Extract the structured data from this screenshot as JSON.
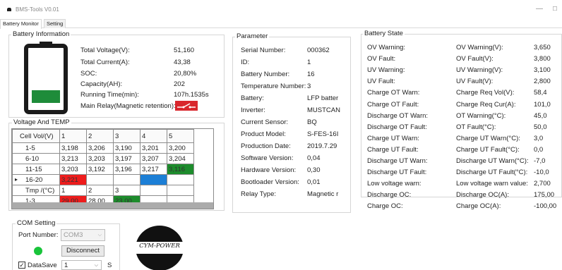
{
  "window": {
    "title": "BMS-Tools V0.01",
    "minimize_glyph": "—",
    "maximize_glyph": "☐"
  },
  "tabs": [
    "Battery Monitor",
    "Setting"
  ],
  "battery_info": {
    "title": "Battery Information",
    "soc_fill_color": "#1e8c3a",
    "relay_icon_color": "#d9262c",
    "rows": [
      {
        "label": "Total Voltage(V):",
        "value": "51,160"
      },
      {
        "label": "Total Current(A):",
        "value": "43,38"
      },
      {
        "label": "SOC:",
        "value": "20,80%"
      },
      {
        "label": "Capacity(AH):",
        "value": "202"
      },
      {
        "label": "Running Time(min):",
        "value": "107h.1535s"
      },
      {
        "label": "Main Relay(Magnetic retention):",
        "value": ""
      }
    ]
  },
  "voltage_temp": {
    "title": "Voltage And TEMP",
    "row_indicator": "▸",
    "header": [
      "Cell Vol/(V)",
      "1",
      "2",
      "3",
      "4",
      "5"
    ],
    "rows": [
      {
        "cells": [
          "1-5",
          "3,198",
          "3,206",
          "3,190",
          "3,201",
          "3,200"
        ],
        "colors": [
          "",
          "",
          "",
          "",
          "",
          ""
        ],
        "current": false
      },
      {
        "cells": [
          "6-10",
          "3,213",
          "3,203",
          "3,197",
          "3,207",
          "3,204"
        ],
        "colors": [
          "",
          "",
          "",
          "",
          "",
          ""
        ],
        "current": false
      },
      {
        "cells": [
          "11-15",
          "3,203",
          "3,192",
          "3,196",
          "3,217",
          "3,116"
        ],
        "colors": [
          "",
          "",
          "",
          "",
          "",
          "#1d8c2c"
        ],
        "current": false
      },
      {
        "cells": [
          "16-20",
          "3,221",
          "",
          "",
          "",
          ""
        ],
        "colors": [
          "",
          "#ee1c1c",
          "",
          "",
          "#1c7fd6",
          ""
        ],
        "current": true
      },
      {
        "cells": [
          "Tmp /(°C)",
          "1",
          "2",
          "3",
          "",
          ""
        ],
        "colors": [
          "",
          "",
          "",
          "",
          "",
          ""
        ],
        "current": false
      },
      {
        "cells": [
          "1-3",
          "29,00",
          "28,00",
          "23,00",
          "",
          ""
        ],
        "colors": [
          "",
          "#ee1c1c",
          "",
          "#1d8c2c",
          "",
          ""
        ],
        "current": false
      }
    ]
  },
  "parameter": {
    "title": "Parameter",
    "rows": [
      {
        "label": "Serial Number:",
        "value": "000362"
      },
      {
        "label": "ID:",
        "value": "1"
      },
      {
        "label": "Battery Number:",
        "value": "16"
      },
      {
        "label": "Temperature Number:",
        "value": "3"
      },
      {
        "label": "Battery:",
        "value": "LFP batter"
      },
      {
        "label": "Inverter:",
        "value": "MUSTCAN"
      },
      {
        "label": "Current Sensor:",
        "value": "BQ"
      },
      {
        "label": "Product Model:",
        "value": "S-FES-16I"
      },
      {
        "label": "Production Date:",
        "value": "2019.7.29"
      },
      {
        "label": "Software Version:",
        "value": "0,04"
      },
      {
        "label": "Hardware Version:",
        "value": "0,30"
      },
      {
        "label": "Bootloader Version:",
        "value": "0,01"
      },
      {
        "label": "Relay Type:",
        "value": "Magnetic r"
      }
    ]
  },
  "battery_state": {
    "title": "Battery State",
    "rows": [
      {
        "left": "OV Warning:",
        "mid": "OV Warning(V):",
        "value": "3,650"
      },
      {
        "left": "OV Fault:",
        "mid": "OV Fault(V):",
        "value": "3,800"
      },
      {
        "left": "UV Warning:",
        "mid": "UV Warning(V):",
        "value": "3,100"
      },
      {
        "left": "UV Fault:",
        "mid": "UV Fault(V):",
        "value": "2,800"
      },
      {
        "left": "Charge OT Warn:",
        "mid": "Charge Req Vol(V):",
        "value": "58,4"
      },
      {
        "left": "Charge OT Fault:",
        "mid": "Charge Req Cur(A):",
        "value": "101,0"
      },
      {
        "left": "Discharge OT Warn:",
        "mid": "OT Warning(°C):",
        "value": "45,0"
      },
      {
        "left": "Discharge OT Fault:",
        "mid": "OT Fault(°C):",
        "value": "50,0"
      },
      {
        "left": "Charge UT Warn:",
        "mid": "Charge UT Warn(°C):",
        "value": "3,0"
      },
      {
        "left": "Charge UT Fault:",
        "mid": "Charge UT Fault(°C):",
        "value": "0,0"
      },
      {
        "left": "Discharge UT Warn:",
        "mid": "Discharge UT Warn(°C):",
        "value": "-7,0"
      },
      {
        "left": "Discharge UT Fault:",
        "mid": "Discharge UT Fault(°C):",
        "value": "-10,0"
      },
      {
        "left": "Low voltage warn:",
        "mid": "Low voltage warn value:",
        "value": "2,700"
      },
      {
        "left": "Discharge OC:",
        "mid": "Discharge OC(A):",
        "value": "175,00"
      },
      {
        "left": "Charge OC:",
        "mid": "Charge OC(A):",
        "value": "-100,00"
      }
    ]
  },
  "com_setting": {
    "title": "COM Setting",
    "port_label": "Port Number:",
    "port_value": "COM3",
    "status_color": "#19c43a",
    "disconnect_label": "Disconnect",
    "datasave_label": "DataSave",
    "datasave_checked": true,
    "interval_value": "1",
    "interval_unit": "S"
  },
  "logo": {
    "text": "CYM-POWER"
  }
}
